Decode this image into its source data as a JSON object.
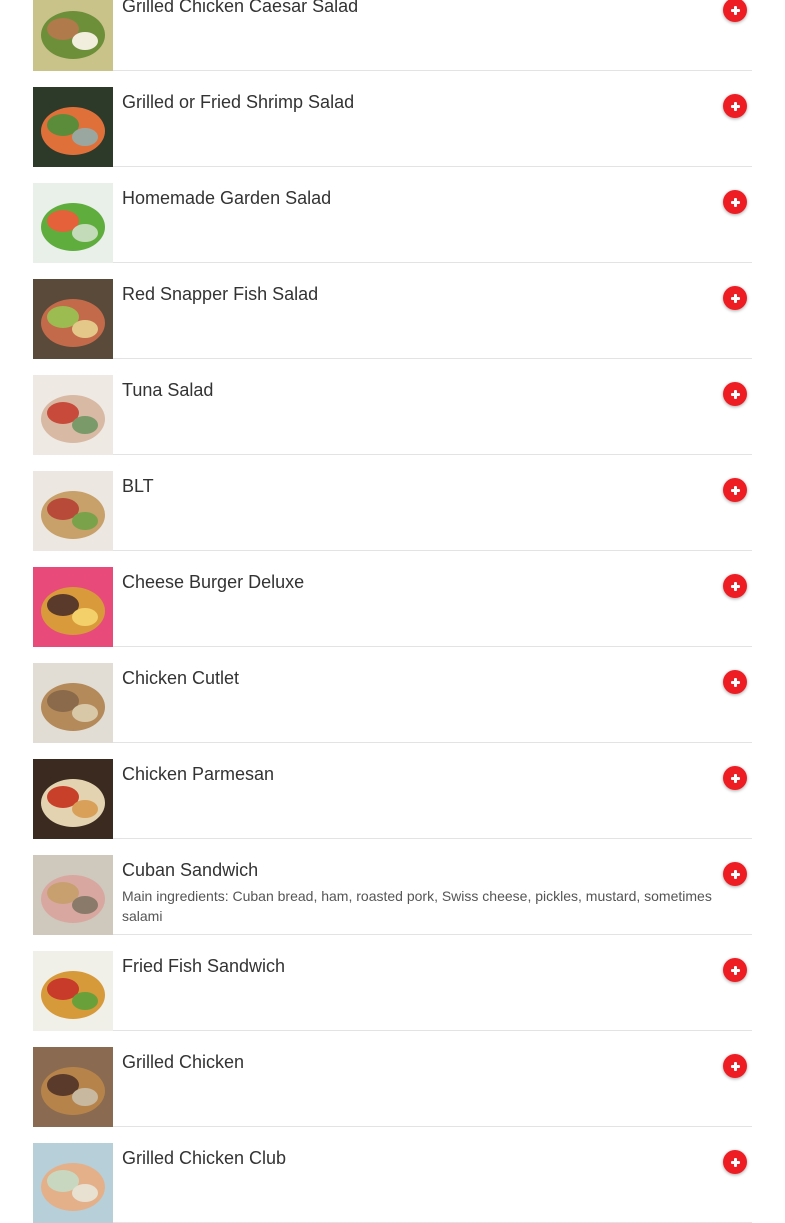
{
  "menu": {
    "items": [
      {
        "name": "Grilled Chicken Caesar Salad",
        "description": "",
        "photo": "caesar-salad-photo",
        "colors": [
          "#c9c38a",
          "#6d8f3a",
          "#b07a4a",
          "#f1eedd"
        ]
      },
      {
        "name": "Grilled or Fried Shrimp Salad",
        "description": "",
        "photo": "shrimp-salad-photo",
        "colors": [
          "#2d3a2a",
          "#e0703a",
          "#5b8c3a",
          "#9aa7a0"
        ]
      },
      {
        "name": "Homemade Garden Salad",
        "description": "",
        "photo": "garden-salad-photo",
        "colors": [
          "#e9efe9",
          "#5fae3d",
          "#e4613a",
          "#c3dbb8"
        ]
      },
      {
        "name": "Red Snapper Fish Salad",
        "description": "",
        "photo": "fish-salad-photo",
        "colors": [
          "#5a4a3a",
          "#c36a4a",
          "#9cbc52",
          "#e4c88a"
        ]
      },
      {
        "name": "Tuna Salad",
        "description": "",
        "photo": "tuna-salad-photo",
        "colors": [
          "#efe9e4",
          "#d8b9a4",
          "#c84a3a",
          "#7a9a6a"
        ]
      },
      {
        "name": "BLT",
        "description": "",
        "photo": "blt-sandwich-photo",
        "colors": [
          "#ece7e0",
          "#c8a06a",
          "#b84a3a",
          "#7aa24a"
        ]
      },
      {
        "name": "Cheese Burger Deluxe",
        "description": "",
        "photo": "cheeseburger-photo",
        "colors": [
          "#e84a7a",
          "#d89a3a",
          "#5a3a2a",
          "#f3d06a"
        ]
      },
      {
        "name": "Chicken Cutlet",
        "description": "",
        "photo": "chicken-cutlet-photo",
        "colors": [
          "#e2ddd4",
          "#b48a5a",
          "#8a6a4a",
          "#d8c8a8"
        ]
      },
      {
        "name": "Chicken Parmesan",
        "description": "",
        "photo": "chicken-parmesan-photo",
        "colors": [
          "#3a2a20",
          "#e3d3b0",
          "#c8402a",
          "#d9a05a"
        ]
      },
      {
        "name": "Cuban Sandwich",
        "description": "Main ingredients: Cuban bread, ham, roasted pork, Swiss cheese, pickles, mustard, sometimes salami",
        "photo": "cuban-sandwich-photo",
        "colors": [
          "#cfc8bc",
          "#d8a8a0",
          "#c8a070",
          "#8a7a6a"
        ]
      },
      {
        "name": "Fried Fish Sandwich",
        "description": "",
        "photo": "fried-fish-sandwich-photo",
        "colors": [
          "#f0efe8",
          "#d79a3a",
          "#c83a2a",
          "#6aa03a"
        ]
      },
      {
        "name": "Grilled Chicken",
        "description": "",
        "photo": "grilled-chicken-sandwich-photo",
        "colors": [
          "#8a6a50",
          "#b6844a",
          "#5a3a2a",
          "#c8b8a0"
        ]
      },
      {
        "name": "Grilled Chicken Club",
        "description": "",
        "photo": "chicken-club-photo",
        "colors": [
          "#b7cfd9",
          "#e4b08a",
          "#c8d8c0",
          "#e8e0d0"
        ]
      }
    ],
    "add_button_icon": "plus-icon",
    "accent_color": "#ee1d23"
  }
}
